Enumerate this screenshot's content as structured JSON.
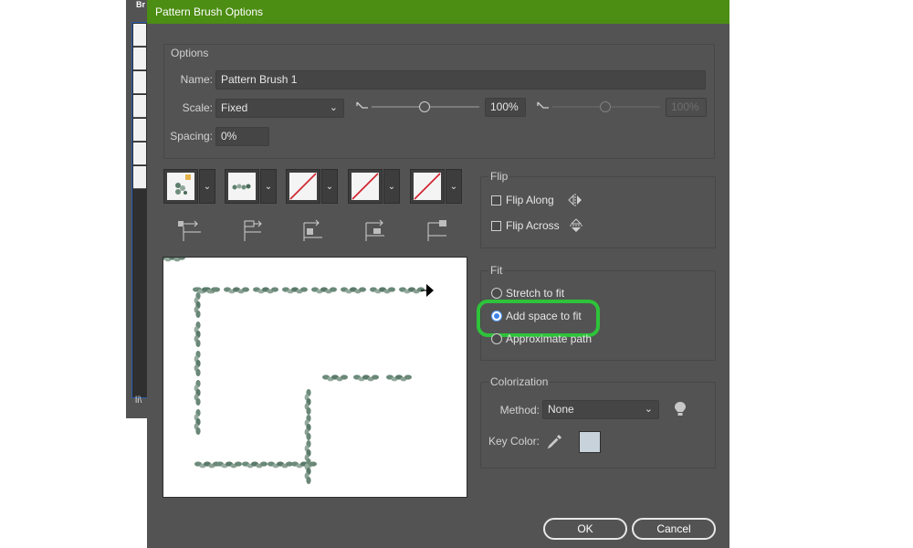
{
  "background_window": {
    "title_fragment": "Br",
    "footer_fragment": "li\\"
  },
  "dialog": {
    "title": "Pattern Brush Options",
    "options_group": {
      "title": "Options",
      "name_label": "Name:",
      "name_value": "Pattern Brush 1",
      "scale_label": "Scale:",
      "scale_value": "Fixed",
      "scale_percent": "100%",
      "scale_percent_max": "100%",
      "spacing_label": "Spacing:",
      "spacing_value": "0%"
    },
    "tiles": [
      {
        "name": "side-tile",
        "content": "pattern"
      },
      {
        "name": "outer-corner-tile",
        "content": "pattern"
      },
      {
        "name": "inner-corner-tile",
        "content": "none"
      },
      {
        "name": "start-tile",
        "content": "none"
      },
      {
        "name": "end-tile",
        "content": "none"
      }
    ],
    "flip_group": {
      "title": "Flip",
      "flip_along": "Flip Along",
      "flip_across": "Flip Across"
    },
    "fit_group": {
      "title": "Fit",
      "options": [
        "Stretch to fit",
        "Add space to fit",
        "Approximate path"
      ],
      "selected": "Add space to fit"
    },
    "colorization_group": {
      "title": "Colorization",
      "method_label": "Method:",
      "method_value": "None",
      "key_color_label": "Key Color:",
      "key_color": "#c7d2da"
    },
    "buttons": {
      "ok": "OK",
      "cancel": "Cancel"
    },
    "colors": {
      "titlebar": "#4c8d13",
      "panel": "#535353",
      "highlight": "#2ec33a"
    }
  }
}
